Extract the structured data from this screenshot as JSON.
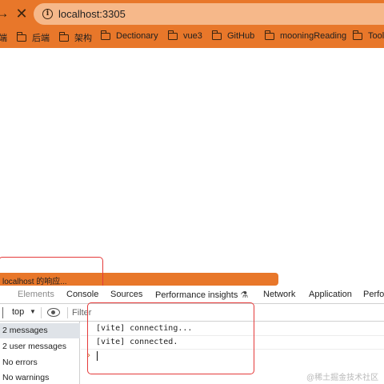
{
  "browser": {
    "url": "localhost:3305",
    "forward_glyph": "→",
    "stop_glyph": "✕"
  },
  "bookmarks": [
    {
      "label": "端"
    },
    {
      "label": "后端"
    },
    {
      "label": "架构"
    },
    {
      "label": "Dectionary"
    },
    {
      "label": "vue3"
    },
    {
      "label": "GitHub"
    },
    {
      "label": "mooningReading"
    },
    {
      "label": "Tools"
    }
  ],
  "page": {
    "loading_status": "localhost 的响应..."
  },
  "devtools": {
    "tabs": [
      {
        "label": "Elements"
      },
      {
        "label": "Console"
      },
      {
        "label": "Sources"
      },
      {
        "label": "Performance insights"
      },
      {
        "label": "Network"
      },
      {
        "label": "Application"
      },
      {
        "label": "Perfor"
      }
    ],
    "context": "top",
    "filter_placeholder": "Filter",
    "sidebar": [
      {
        "label": "2 messages",
        "active": true
      },
      {
        "label": "2 user messages"
      },
      {
        "label": "No errors"
      },
      {
        "label": "No warnings"
      }
    ],
    "logs": [
      "[vite] connecting...",
      "[vite] connected."
    ]
  },
  "watermark": "@稀土掘金技术社区",
  "colors": {
    "chrome_orange": "#e8772a",
    "highlight_red": "#e53b3b"
  }
}
